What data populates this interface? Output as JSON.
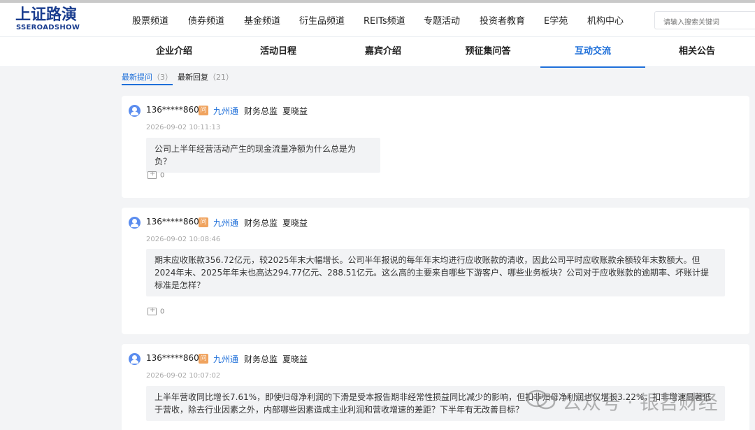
{
  "brand": {
    "name_cn": "上证路演",
    "name_en": "SSEROADSHOW"
  },
  "main_nav": [
    "股票频道",
    "债券频道",
    "基金频道",
    "衍生品频道",
    "REITs频道",
    "专题活动",
    "投资者教育",
    "E学苑",
    "机构中心"
  ],
  "search": {
    "placeholder": "请输入搜索关键词"
  },
  "sub_tabs": [
    {
      "label": "企业介绍",
      "active": false
    },
    {
      "label": "活动日程",
      "active": false
    },
    {
      "label": "嘉宾介绍",
      "active": false
    },
    {
      "label": "预征集问答",
      "active": false
    },
    {
      "label": "互动交流",
      "active": true
    },
    {
      "label": "相关公告",
      "active": false
    }
  ],
  "list_tabs": [
    {
      "label": "最新提问",
      "count": "（3）",
      "active": true
    },
    {
      "label": "最新回复",
      "count": "（21）",
      "active": false
    }
  ],
  "questions": [
    {
      "user": "136*****860",
      "badge": "问",
      "company": "九州通",
      "role": "财务总监",
      "person": "夏晓益",
      "time": "2026-09-02 10:11:13",
      "text": "公司上半年经营活动产生的现金流量净额为什么总是为负？",
      "replies": "0"
    },
    {
      "user": "136*****860",
      "badge": "问",
      "company": "九州通",
      "role": "财务总监",
      "person": "夏晓益",
      "time": "2026-09-02 10:08:46",
      "text": "期末应收账款356.72亿元，较2025年末大幅增长。公司半年报说的每年年末均进行应收账款的清收，因此公司平时应收账款余额较年末数额大。但2024年末、2025年年末也高达294.77亿元、288.51亿元。这么高的主要来自哪些下游客户、哪些业务板块？公司对于应收账款的逾期率、坏账计提标准是怎样？",
      "replies": "0"
    },
    {
      "user": "136*****860",
      "badge": "问",
      "company": "九州通",
      "role": "财务总监",
      "person": "夏晓益",
      "time": "2026-09-02 10:07:02",
      "text": "上半年营收同比增长7.61%，即使归母净利润的下滑是受本报告期非经常性损益同比减少的影响，但扣非归母净利润也仅增长3.22%，扣非增速显著低于营收，除去行业因素之外，内部哪些因素造成主业利润和营收增速的差距？下半年有无改善目标？",
      "replies": ""
    }
  ],
  "watermark": {
    "text": "公众号 · 银苕财经"
  }
}
